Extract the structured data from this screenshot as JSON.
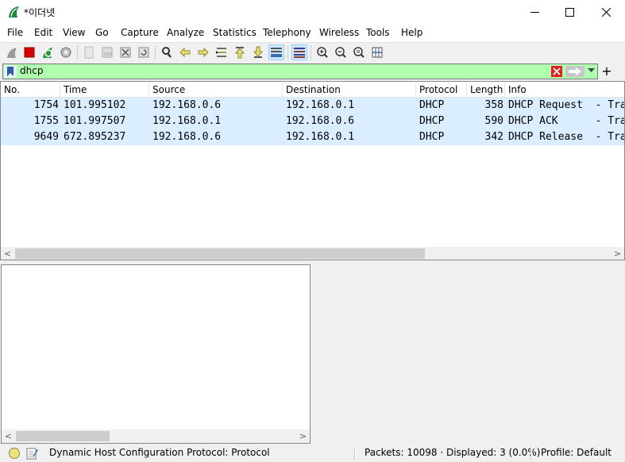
{
  "window": {
    "title": "*이더넷",
    "minimize_glyph": "—",
    "maximize_glyph": "☐",
    "close_glyph": "✕"
  },
  "menu": [
    "File",
    "Edit",
    "View",
    "Go",
    "Capture",
    "Analyze",
    "Statistics",
    "Telephony",
    "Wireless",
    "Tools",
    "Help"
  ],
  "toolbar": {
    "icons": [
      "shark-fin-start-icon",
      "stop-capture-icon",
      "restart-capture-icon",
      "capture-options-icon",
      "open-file-icon",
      "save-file-icon",
      "close-file-icon",
      "reload-file-icon",
      "find-packet-icon",
      "go-back-icon",
      "go-forward-icon",
      "go-to-packet-icon",
      "go-first-icon",
      "go-last-icon",
      "autoscroll-icon",
      "colorize-icon",
      "zoom-in-icon",
      "zoom-out-icon",
      "normal-size-icon",
      "resize-columns-icon"
    ]
  },
  "filter": {
    "value": "dhcp",
    "add_glyph": "+",
    "bg_color": "#afffaf"
  },
  "packet_list": {
    "columns": [
      "No.",
      "Time",
      "Source",
      "Destination",
      "Protocol",
      "Length",
      "Info"
    ],
    "rows": [
      {
        "no": "1754",
        "time": "101.995102",
        "source": "192.168.0.6",
        "destination": "192.168.0.1",
        "protocol": "DHCP",
        "length": "358",
        "info": "DHCP Request  - Tra"
      },
      {
        "no": "1755",
        "time": "101.997507",
        "source": "192.168.0.1",
        "destination": "192.168.0.6",
        "protocol": "DHCP",
        "length": "590",
        "info": "DHCP ACK      - Tra"
      },
      {
        "no": "9649",
        "time": "672.895237",
        "source": "192.168.0.6",
        "destination": "192.168.0.1",
        "protocol": "DHCP",
        "length": "342",
        "info": "DHCP Release  - Tra"
      }
    ],
    "row_color": "#daeeff",
    "scroll_left": "<",
    "scroll_right": ">"
  },
  "status": {
    "protocol_text": "Dynamic Host Configuration Protocol: Protocol",
    "packets_text": "Packets: 10098 · Displayed: 3 (0.0%)",
    "profile_text": "Profile: Default"
  }
}
